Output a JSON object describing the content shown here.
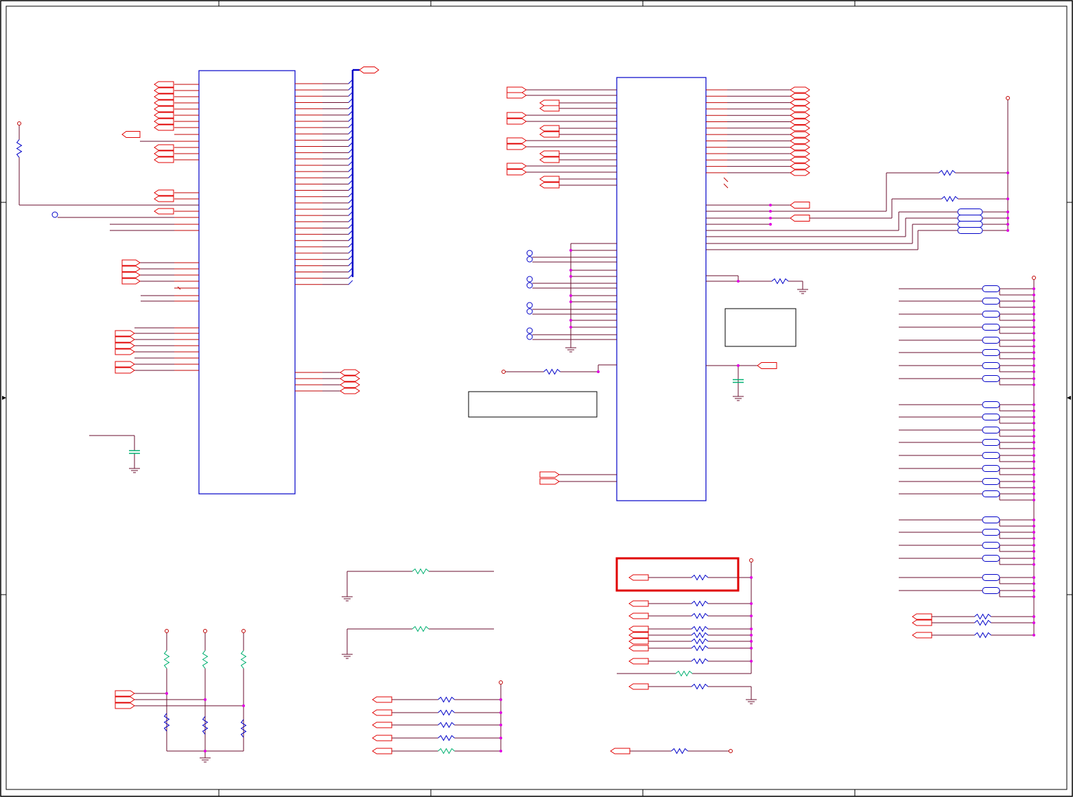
{
  "window": {
    "title": ""
  },
  "colors": {
    "border": "#000000",
    "ic_outline": "#0000c8",
    "wire": "#6a0d2e",
    "pin": "#c00000",
    "net_port": "#e00000",
    "junction": "#e000e0",
    "resistor": "#0000c8",
    "capacitor": "#00b070",
    "power": "#c00000",
    "highlight": "#e00000"
  },
  "icons": {
    "net_port": "pentagon-port-icon",
    "power": "power-pin-icon",
    "ground": "ground-icon",
    "resistor": "resistor-zigzag-icon",
    "capacitor": "capacitor-icon",
    "test_point": "test-point-icon"
  },
  "ui": {
    "highlight_box": "selection-highlight"
  },
  "status": {
    "text": ""
  }
}
